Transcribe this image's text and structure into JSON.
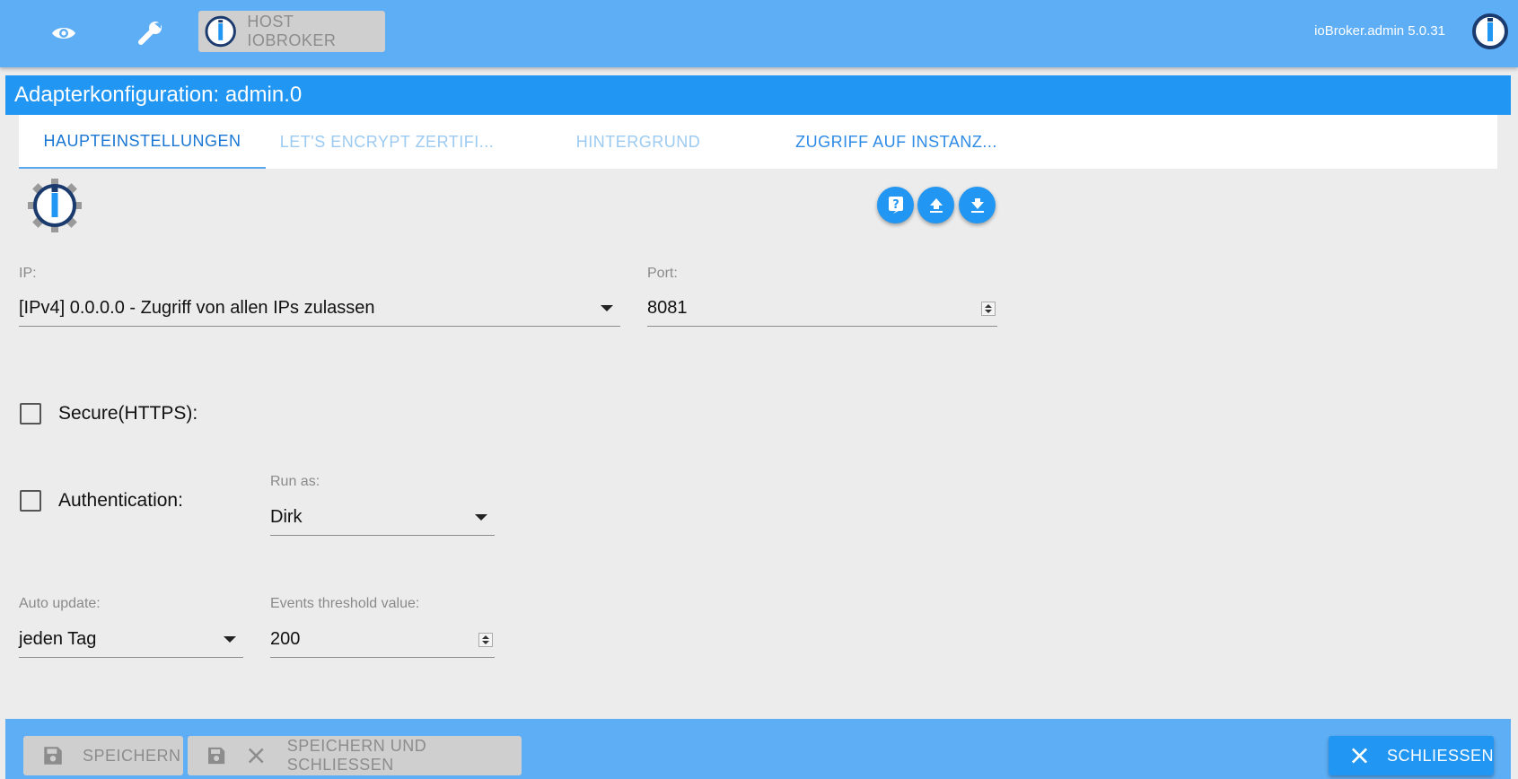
{
  "topbar": {
    "host_label": "HOST IOBROKER",
    "version": "ioBroker.admin 5.0.31",
    "icons": [
      "eye-icon",
      "wrench-icon",
      "iobroker-logo-icon"
    ]
  },
  "dialog": {
    "title": "Adapterkonfiguration: admin.0"
  },
  "tabs": [
    {
      "label": "HAUPTEINSTELLUNGEN",
      "state": "active"
    },
    {
      "label": "LET'S ENCRYPT ZERTIFI...",
      "state": "faded"
    },
    {
      "label": "HINTERGRUND",
      "state": "faded"
    },
    {
      "label": "ZUGRIFF AUF INSTANZ...",
      "state": "normal"
    }
  ],
  "action_icons": [
    "help-icon",
    "upload-icon",
    "download-icon"
  ],
  "form": {
    "ip": {
      "label": "IP:",
      "value": "[IPv4] 0.0.0.0 - Zugriff von allen IPs zulassen"
    },
    "port": {
      "label": "Port:",
      "value": "8081"
    },
    "secure": {
      "label": "Secure(HTTPS):",
      "checked": false
    },
    "auth": {
      "label": "Authentication:",
      "checked": false
    },
    "run_as": {
      "label": "Run as:",
      "value": "Dirk"
    },
    "auto_update": {
      "label": "Auto update:",
      "value": "jeden Tag"
    },
    "events_threshold": {
      "label": "Events threshold value:",
      "value": "200"
    }
  },
  "footer": {
    "save_label": "SPEICHERN",
    "save_close_label": "SPEICHERN UND SCHLIESSEN",
    "close_label": "SCHLIESSEN"
  },
  "colors": {
    "topbar": "#5eaef5",
    "title_bar": "#2196f3",
    "tab_active": "#1976d2",
    "background": "#ececec"
  }
}
